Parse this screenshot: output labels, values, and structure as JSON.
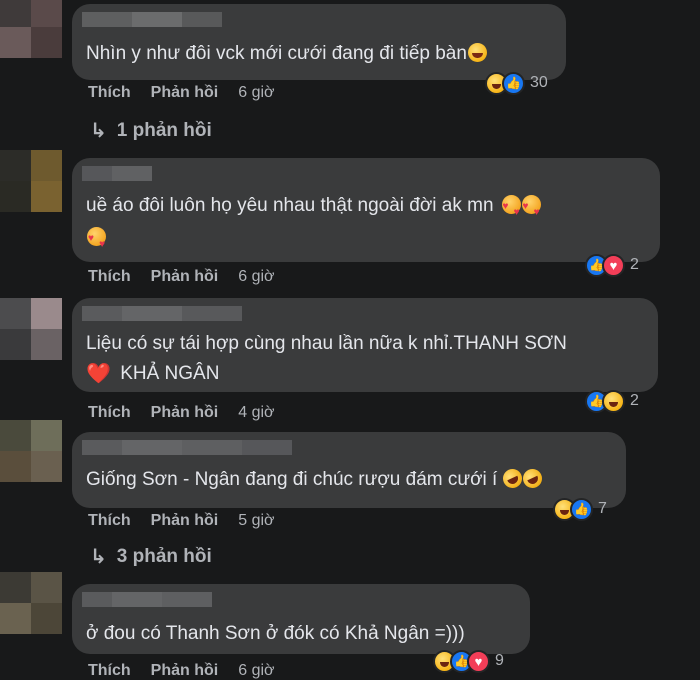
{
  "labels": {
    "like": "Thích",
    "reply": "Phản hồi"
  },
  "icons": {
    "reply_arrow": "reply-arrow-icon",
    "like": "like-icon",
    "haha": "haha-icon",
    "love": "love-icon"
  },
  "comments": [
    {
      "lines": [
        "Nhìn y như đôi vck mới cưới đang đi tiếp bàn"
      ],
      "time": "6 giờ",
      "reaction_count": "30",
      "replies": "1 phản hồi"
    },
    {
      "lines": [
        "uề áo đôi luôn họ yêu nhau thật ngoài đời ak mn"
      ],
      "time": "6 giờ",
      "reaction_count": "2"
    },
    {
      "lines": [
        "Liệu có sự tái hợp cùng nhau lần nữa k nhỉ.THANH SƠN",
        "KHẢ NGÂN"
      ],
      "time": "4 giờ",
      "reaction_count": "2"
    },
    {
      "lines": [
        "Giống Sơn - Ngân đang đi chúc rượu đám cưới í"
      ],
      "time": "5 giờ",
      "reaction_count": "7",
      "replies": "3 phản hồi"
    },
    {
      "lines": [
        "ở đou có Thanh Sơn ở đók có Khả Ngân =)))"
      ],
      "time": "6 giờ",
      "reaction_count": "9"
    }
  ]
}
